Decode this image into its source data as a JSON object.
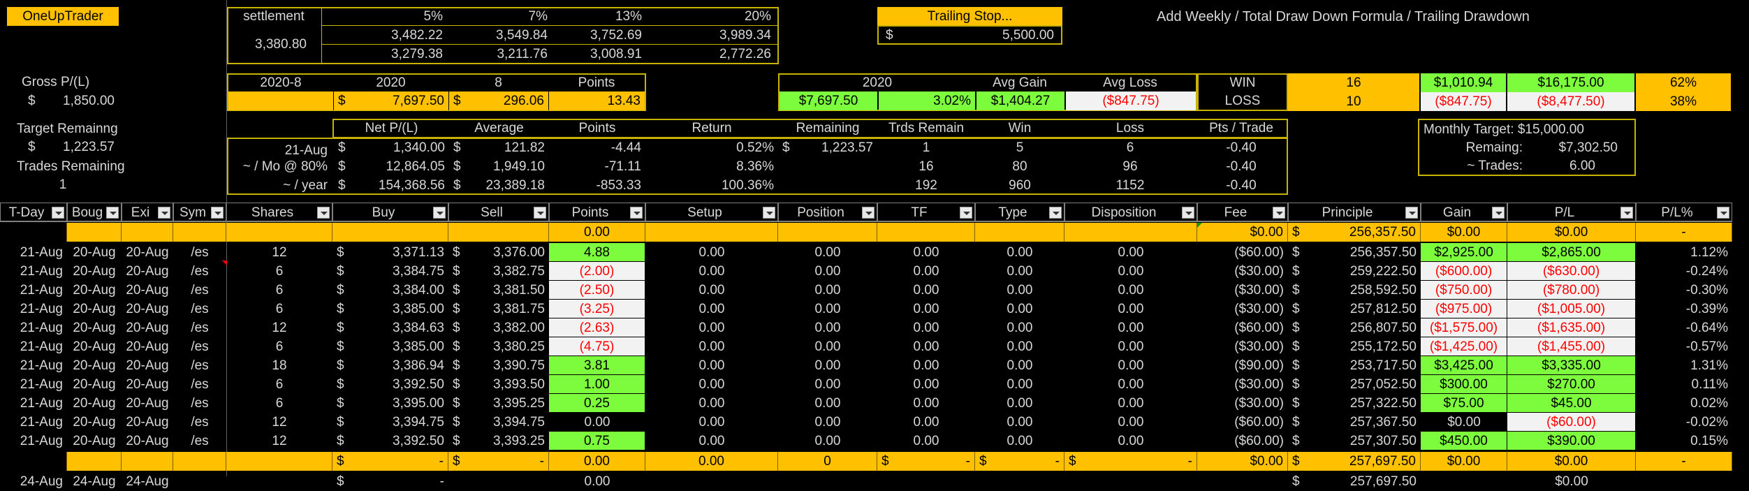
{
  "app_label": "OneUpTrader",
  "settlement": {
    "label": "settlement",
    "base": "3,380.80",
    "cols": [
      "5%",
      "7%",
      "13%",
      "20%"
    ],
    "row1": [
      "3,482.22",
      "3,549.84",
      "3,752.69",
      "3,989.34"
    ],
    "row2": [
      "3,279.38",
      "3,211.76",
      "3,008.91",
      "2,772.26"
    ]
  },
  "trailing_stop": {
    "label": "Trailing Stop...",
    "value": "5,500.00"
  },
  "formula_note": "Add Weekly / Total Draw Down Formula / Trailing Drawdown",
  "gross": {
    "label": "Gross P/(L)",
    "value": "1,850.00"
  },
  "target": {
    "label": "Target Remainng",
    "value": "1,223.57"
  },
  "trades_remaining": {
    "label": "Trades Remaining",
    "value": "1"
  },
  "period": {
    "h1": "2020-8",
    "h2": "2020",
    "h3": "8",
    "h4": "Points",
    "v2": "7,697.50",
    "v3": "296.06",
    "v4": "13.43"
  },
  "year_stats": {
    "h1": "2020",
    "h2": "Avg Gain",
    "h3": "Avg Loss",
    "v1": "$7,697.50",
    "v1b": "3.02%",
    "v2": "$1,404.27",
    "v3": "($847.75)"
  },
  "winloss": {
    "win": {
      "label": "WIN",
      "count": "16",
      "avg": "$1,010.94",
      "total": "$16,175.00",
      "pct": "62%"
    },
    "loss": {
      "label": "LOSS",
      "count": "10",
      "avg": "($847.75)",
      "total": "($8,477.50)",
      "pct": "38%"
    }
  },
  "monthly": {
    "target_label": "Monthly Target:",
    "target": "$15,000.00",
    "remain_label": "Remaing:",
    "remain": "$7,302.50",
    "trades_label": "~ Trades:",
    "trades": "6.00"
  },
  "summary": {
    "headers": [
      "Net P/(L)",
      "Average",
      "Points",
      "Return",
      "Remaining",
      "Trds Remain",
      "Win",
      "Loss",
      "Pts / Trade"
    ],
    "rows": [
      {
        "label": "21-Aug",
        "net": "1,340.00",
        "avg": "121.82",
        "pts": "-4.44",
        "ret": "0.52%",
        "rem": "1,223.57",
        "trds": "1",
        "win": "5",
        "loss": "6",
        "ppt": "-0.40"
      },
      {
        "label": "~ / Mo @ 80%",
        "net": "12,864.05",
        "avg": "1,949.10",
        "pts": "-71.11",
        "ret": "8.36%",
        "rem": "",
        "trds": "16",
        "win": "80",
        "loss": "96",
        "ppt": "-0.40"
      },
      {
        "label": "~ / year",
        "net": "154,368.56",
        "avg": "23,389.18",
        "pts": "-853.33",
        "ret": "100.36%",
        "rem": "",
        "trds": "192",
        "win": "960",
        "loss": "1152",
        "ppt": "-0.40"
      }
    ]
  },
  "table": {
    "headers": [
      "T-Day",
      "Boug",
      "Exi",
      "Sym",
      "Shares",
      "Buy",
      "Sell",
      "Points",
      "Setup",
      "Position",
      "TF",
      "Type",
      "Disposition",
      "Fee",
      "Principle",
      "Gain",
      "P/L",
      "P/L%"
    ],
    "top_row": {
      "points": "0.00",
      "fee": "$0.00",
      "principle": "256,357.50",
      "gain": "$0.00",
      "pl": "$0.00",
      "plpct": "-"
    },
    "rows": [
      {
        "tday": "21-Aug",
        "boug": "20-Aug",
        "exit": "20-Aug",
        "sym": "/es",
        "shares": "12",
        "buy": "3,371.13",
        "sell": "3,376.00",
        "points": "4.88",
        "pts_style": "green",
        "setup": "0.00",
        "position": "0.00",
        "tf": "0.00",
        "type": "0.00",
        "disp": "0.00",
        "fee": "($60.00)",
        "principle": "256,357.50",
        "gain": "$2,925.00",
        "gain_style": "green",
        "pl": "$2,865.00",
        "pl_style": "green",
        "plpct": "1.12%"
      },
      {
        "tday": "21-Aug",
        "boug": "20-Aug",
        "exit": "20-Aug",
        "sym": "/es",
        "shares": "6",
        "buy": "3,384.75",
        "sell": "3,382.75",
        "points": "(2.00)",
        "pts_style": "pale",
        "setup": "0.00",
        "position": "0.00",
        "tf": "0.00",
        "type": "0.00",
        "disp": "0.00",
        "fee": "($30.00)",
        "principle": "259,222.50",
        "gain": "($600.00)",
        "gain_style": "pale",
        "pl": "($630.00)",
        "pl_style": "pale",
        "plpct": "-0.24%"
      },
      {
        "tday": "21-Aug",
        "boug": "20-Aug",
        "exit": "20-Aug",
        "sym": "/es",
        "shares": "6",
        "buy": "3,384.00",
        "sell": "3,381.50",
        "points": "(2.50)",
        "pts_style": "pale",
        "setup": "0.00",
        "position": "0.00",
        "tf": "0.00",
        "type": "0.00",
        "disp": "0.00",
        "fee": "($30.00)",
        "principle": "258,592.50",
        "gain": "($750.00)",
        "gain_style": "pale",
        "pl": "($780.00)",
        "pl_style": "pale",
        "plpct": "-0.30%"
      },
      {
        "tday": "21-Aug",
        "boug": "20-Aug",
        "exit": "20-Aug",
        "sym": "/es",
        "shares": "6",
        "buy": "3,385.00",
        "sell": "3,381.75",
        "points": "(3.25)",
        "pts_style": "pale",
        "setup": "0.00",
        "position": "0.00",
        "tf": "0.00",
        "type": "0.00",
        "disp": "0.00",
        "fee": "($30.00)",
        "principle": "257,812.50",
        "gain": "($975.00)",
        "gain_style": "pale",
        "pl": "($1,005.00)",
        "pl_style": "pale",
        "plpct": "-0.39%"
      },
      {
        "tday": "21-Aug",
        "boug": "20-Aug",
        "exit": "20-Aug",
        "sym": "/es",
        "shares": "12",
        "buy": "3,384.63",
        "sell": "3,382.00",
        "points": "(2.63)",
        "pts_style": "pale",
        "setup": "0.00",
        "position": "0.00",
        "tf": "0.00",
        "type": "0.00",
        "disp": "0.00",
        "fee": "($60.00)",
        "principle": "256,807.50",
        "gain": "($1,575.00)",
        "gain_style": "pale",
        "pl": "($1,635.00)",
        "pl_style": "pale",
        "plpct": "-0.64%"
      },
      {
        "tday": "21-Aug",
        "boug": "20-Aug",
        "exit": "20-Aug",
        "sym": "/es",
        "shares": "6",
        "buy": "3,385.00",
        "sell": "3,380.25",
        "points": "(4.75)",
        "pts_style": "pale",
        "setup": "0.00",
        "position": "0.00",
        "tf": "0.00",
        "type": "0.00",
        "disp": "0.00",
        "fee": "($30.00)",
        "principle": "255,172.50",
        "gain": "($1,425.00)",
        "gain_style": "pale",
        "pl": "($1,455.00)",
        "pl_style": "pale",
        "plpct": "-0.57%"
      },
      {
        "tday": "21-Aug",
        "boug": "20-Aug",
        "exit": "20-Aug",
        "sym": "/es",
        "shares": "18",
        "buy": "3,386.94",
        "sell": "3,390.75",
        "points": "3.81",
        "pts_style": "green",
        "setup": "0.00",
        "position": "0.00",
        "tf": "0.00",
        "type": "0.00",
        "disp": "0.00",
        "fee": "($90.00)",
        "principle": "253,717.50",
        "gain": "$3,425.00",
        "gain_style": "green",
        "pl": "$3,335.00",
        "pl_style": "green",
        "plpct": "1.31%"
      },
      {
        "tday": "21-Aug",
        "boug": "20-Aug",
        "exit": "20-Aug",
        "sym": "/es",
        "shares": "6",
        "buy": "3,392.50",
        "sell": "3,393.50",
        "points": "1.00",
        "pts_style": "green",
        "setup": "0.00",
        "position": "0.00",
        "tf": "0.00",
        "type": "0.00",
        "disp": "0.00",
        "fee": "($30.00)",
        "principle": "257,052.50",
        "gain": "$300.00",
        "gain_style": "green",
        "pl": "$270.00",
        "pl_style": "green",
        "plpct": "0.11%"
      },
      {
        "tday": "21-Aug",
        "boug": "20-Aug",
        "exit": "20-Aug",
        "sym": "/es",
        "shares": "6",
        "buy": "3,395.00",
        "sell": "3,395.25",
        "points": "0.25",
        "pts_style": "green",
        "setup": "0.00",
        "position": "0.00",
        "tf": "0.00",
        "type": "0.00",
        "disp": "0.00",
        "fee": "($30.00)",
        "principle": "257,322.50",
        "gain": "$75.00",
        "gain_style": "green",
        "pl": "$45.00",
        "pl_style": "green",
        "plpct": "0.02%"
      },
      {
        "tday": "21-Aug",
        "boug": "20-Aug",
        "exit": "20-Aug",
        "sym": "/es",
        "shares": "12",
        "buy": "3,394.75",
        "sell": "3,394.75",
        "points": "0.00",
        "pts_style": "",
        "setup": "0.00",
        "position": "0.00",
        "tf": "0.00",
        "type": "0.00",
        "disp": "0.00",
        "fee": "($60.00)",
        "principle": "257,367.50",
        "gain": "$0.00",
        "gain_style": "",
        "pl": "($60.00)",
        "pl_style": "pale",
        "plpct": "-0.02%"
      },
      {
        "tday": "21-Aug",
        "boug": "20-Aug",
        "exit": "20-Aug",
        "sym": "/es",
        "shares": "12",
        "buy": "3,392.50",
        "sell": "3,393.25",
        "points": "0.75",
        "pts_style": "green",
        "setup": "0.00",
        "position": "0.00",
        "tf": "0.00",
        "type": "0.00",
        "disp": "0.00",
        "fee": "($60.00)",
        "principle": "257,307.50",
        "gain": "$450.00",
        "gain_style": "green",
        "pl": "$390.00",
        "pl_style": "green",
        "plpct": "0.15%"
      }
    ],
    "total_row": {
      "buy": "-",
      "sell": "-",
      "points": "0.00",
      "setup": "0.00",
      "position": "0",
      "tf": "-",
      "type": "-",
      "disp": "-",
      "fee": "$0.00",
      "principle": "257,697.50",
      "gain": "$0.00",
      "pl": "$0.00",
      "plpct": "-"
    },
    "partial_row": {
      "tday": "24-Aug",
      "boug": "24-Aug",
      "exit": "24-Aug",
      "buy": "-",
      "points": "0.00",
      "principle": "257,697.50",
      "pl": "$0.00"
    }
  }
}
